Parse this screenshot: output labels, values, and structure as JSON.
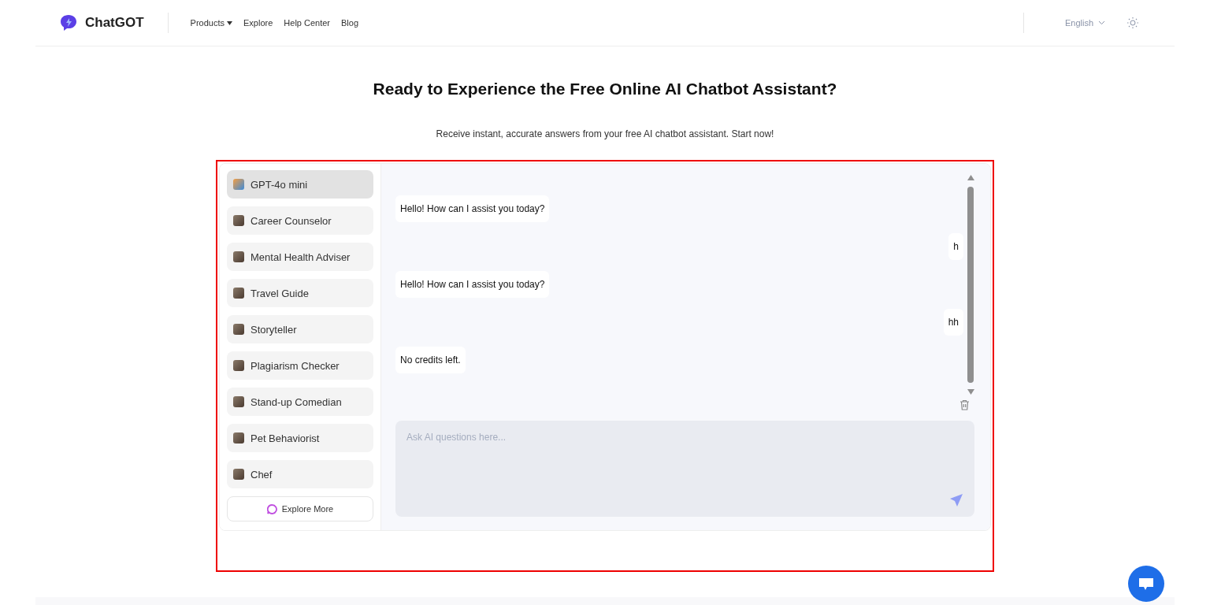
{
  "header": {
    "brand": "ChatGOT",
    "nav": [
      {
        "label": "Products",
        "dropdown": true
      },
      {
        "label": "Explore",
        "dropdown": false
      },
      {
        "label": "Help Center",
        "dropdown": false
      },
      {
        "label": "Blog",
        "dropdown": false
      }
    ],
    "language": "English"
  },
  "hero": {
    "title": "Ready to Experience the Free Online AI Chatbot Assistant?",
    "subtitle": "Receive instant, accurate answers from your free AI chatbot assistant. Start now!"
  },
  "sidebar": {
    "items": [
      {
        "label": "GPT-4o mini",
        "selected": true
      },
      {
        "label": "Career Counselor",
        "selected": false
      },
      {
        "label": "Mental Health Adviser",
        "selected": false
      },
      {
        "label": "Travel Guide",
        "selected": false
      },
      {
        "label": "Storyteller",
        "selected": false
      },
      {
        "label": "Plagiarism Checker",
        "selected": false
      },
      {
        "label": "Stand-up Comedian",
        "selected": false
      },
      {
        "label": "Pet Behaviorist",
        "selected": false
      },
      {
        "label": "Chef",
        "selected": false
      }
    ],
    "explore_more": "Explore More"
  },
  "messages": [
    {
      "kind": "bot",
      "text": "Hello! How can I assist you today?"
    },
    {
      "kind": "user",
      "text": "h"
    },
    {
      "kind": "bot",
      "text": "Hello! How can I assist you today?"
    },
    {
      "kind": "user",
      "text": "hh"
    },
    {
      "kind": "bot",
      "text": "No credits left."
    }
  ],
  "input": {
    "placeholder": "Ask AI questions here..."
  }
}
